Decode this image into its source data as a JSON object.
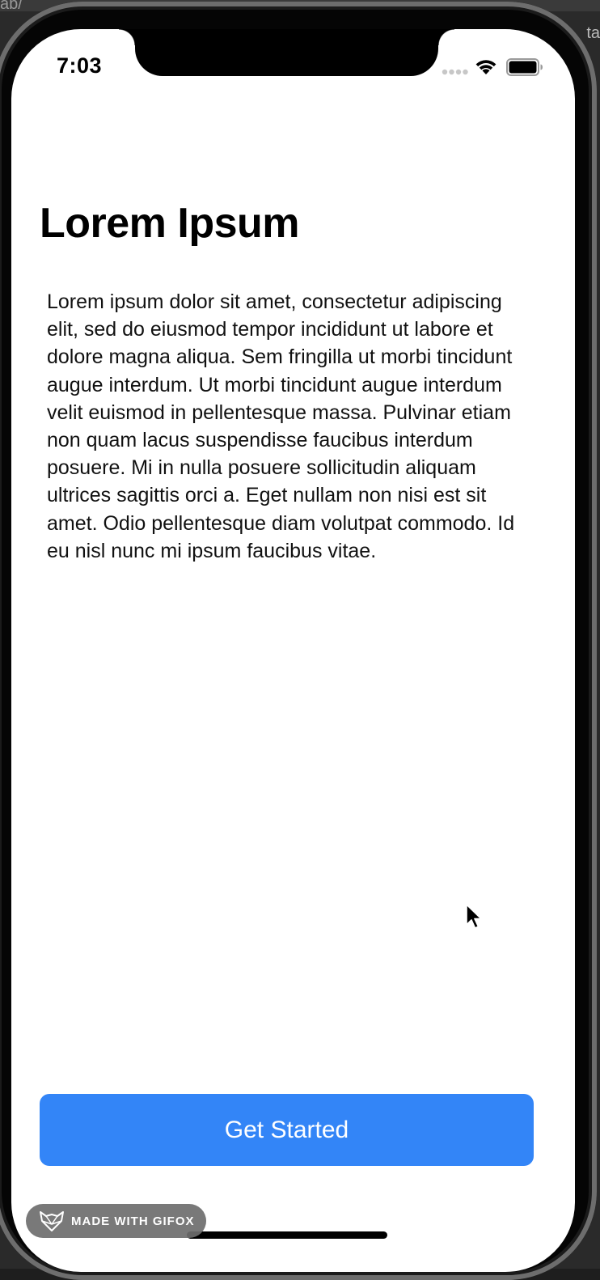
{
  "desktop": {
    "url_fragment": "ab/",
    "right_fragment": "ta"
  },
  "status_bar": {
    "time": "7:03",
    "icons": [
      "cellular-signal-icon",
      "wifi-icon",
      "battery-icon"
    ]
  },
  "content": {
    "title": "Lorem Ipsum",
    "body": "Lorem ipsum dolor sit amet, consectetur adipiscing elit, sed do eiusmod tempor incididunt ut labore et dolore magna aliqua. Sem fringilla ut morbi tincidunt augue interdum. Ut morbi tincidunt augue interdum velit euismod in pellentesque massa. Pulvinar etiam non quam lacus suspendisse faucibus interdum posuere. Mi in nulla posuere sollicitudin aliquam ultrices sagittis orci a. Eget nullam non nisi est sit amet. Odio pellentesque diam volutpat commodo. Id eu nisl nunc mi ipsum faucibus vitae."
  },
  "action": {
    "button_label": "Get Started"
  },
  "watermark": {
    "text": "MADE WITH GIFOX"
  },
  "colors": {
    "accent": "#3385f7",
    "background": "#ffffff",
    "text": "#111111",
    "watermark_bg": "#6e6e6e"
  }
}
